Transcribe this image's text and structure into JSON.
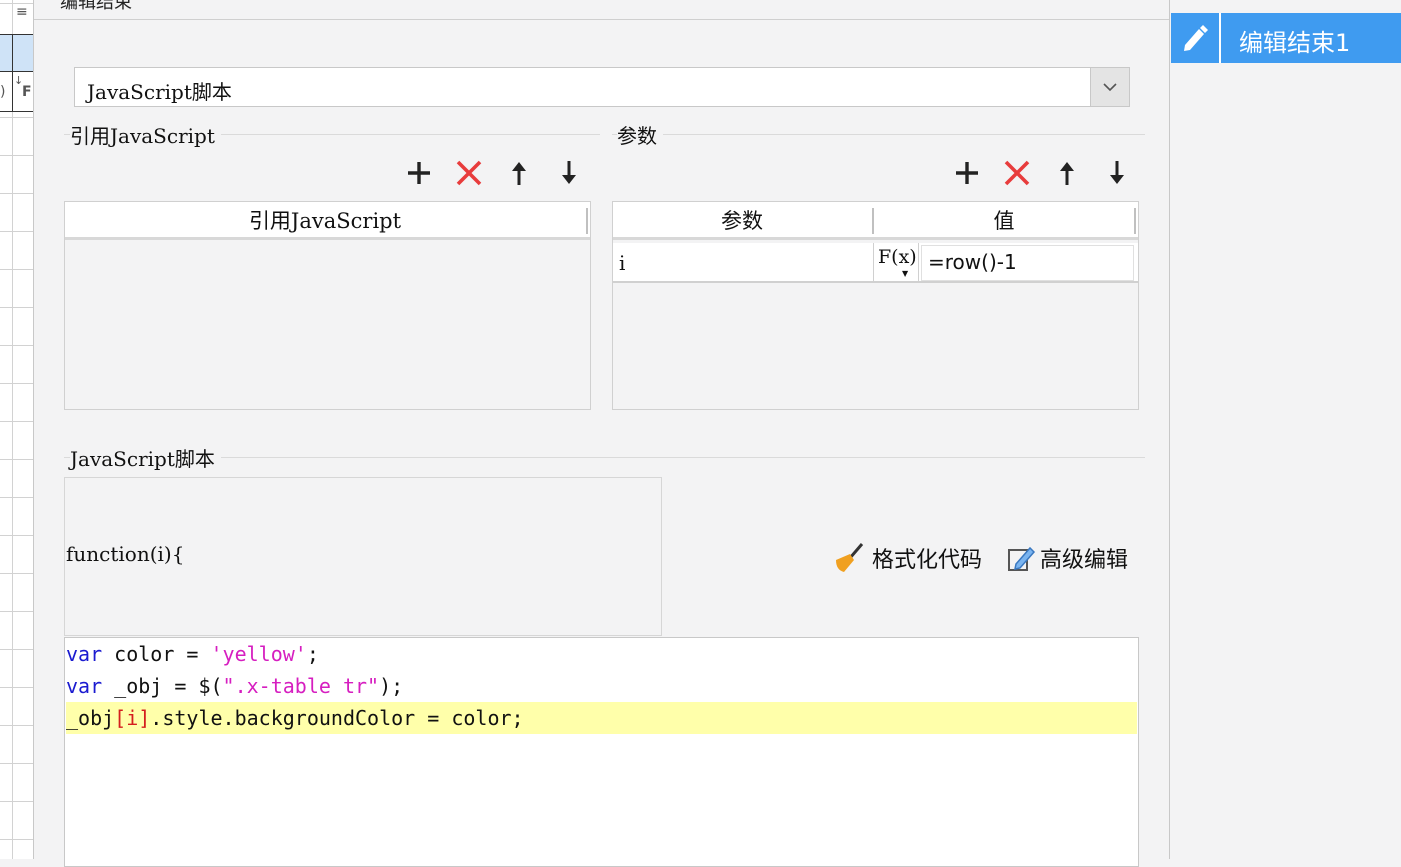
{
  "dialog": {
    "title": "编辑结束",
    "type_select": {
      "value": "JavaScript脚本"
    }
  },
  "ref_js": {
    "section_title": "引用JavaScript",
    "column_header": "引用JavaScript",
    "rows": []
  },
  "params": {
    "section_title": "参数",
    "columns": [
      "参数",
      "值"
    ],
    "rows": [
      {
        "name": "i",
        "formula_label": "F(x)",
        "value": "=row()-1"
      }
    ]
  },
  "script": {
    "section_title": "JavaScript脚本",
    "function_header": "function(i){",
    "format_code_label": "格式化代码",
    "advanced_edit_label": "高级编辑",
    "code_lines": [
      "var color = 'yellow';",
      "var _obj = $(\".x-table tr\");",
      "_obj[i].style.backgroundColor = color;"
    ]
  },
  "right_panel": {
    "event_tab_label": "编辑结束1"
  },
  "colors": {
    "accent": "#3f9bf0",
    "delete_red": "#e83c3c",
    "keyword_blue": "#1b1bd0",
    "string_magenta": "#d61ec0",
    "active_line": "#ffffaa"
  }
}
